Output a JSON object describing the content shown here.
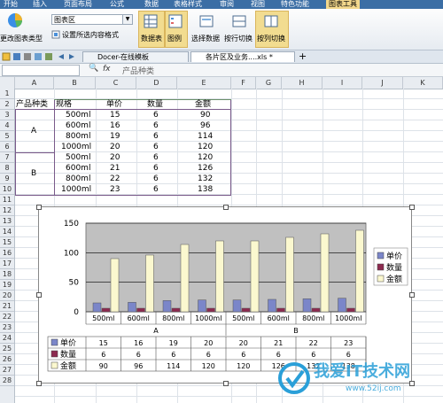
{
  "menubar": {
    "items": [
      "开始",
      "插入",
      "页面布局",
      "公式",
      "数据",
      "表格样式",
      "审阅",
      "视图",
      "特色功能",
      "图表工具"
    ],
    "active_index": 9
  },
  "ribbon": {
    "change_chart_type": "更改图表类型",
    "chart_area_select": "图表区",
    "format_selection": "设置所选内容格式",
    "data_table": "数据表",
    "legend": "图例",
    "select_data": "选择数据",
    "switch_by_row": "按行切换",
    "switch_by_col": "按列切换"
  },
  "tabs": [
    {
      "label": "Docer-在线模板"
    },
    {
      "label": "各片区及业务....xls *"
    }
  ],
  "formula_bar": {
    "fx": "fx",
    "content": "产品种类"
  },
  "columns": [
    "A",
    "B",
    "C",
    "D",
    "E",
    "F",
    "G",
    "H",
    "I",
    "J",
    "K"
  ],
  "rows": [
    "1",
    "2",
    "3",
    "4",
    "5",
    "6",
    "7",
    "8",
    "9",
    "10",
    "11",
    "12",
    "13",
    "14",
    "15",
    "16",
    "17",
    "18",
    "19",
    "20",
    "21",
    "22",
    "23",
    "24",
    "25",
    "26",
    "27",
    "28"
  ],
  "table": {
    "headers": [
      "产品种类",
      "规格",
      "单价",
      "数量",
      "金额"
    ],
    "groups": [
      "A",
      "B"
    ],
    "specs": [
      "500ml",
      "600ml",
      "800ml",
      "1000ml",
      "500ml",
      "600ml",
      "800ml",
      "1000ml"
    ],
    "price": [
      "15",
      "16",
      "19",
      "20",
      "20",
      "21",
      "22",
      "23"
    ],
    "qty": [
      "6",
      "6",
      "6",
      "6",
      "6",
      "6",
      "6",
      "6"
    ],
    "amount": [
      "90",
      "96",
      "114",
      "120",
      "120",
      "126",
      "132",
      "138"
    ]
  },
  "chart_data": {
    "type": "bar",
    "categories": [
      "500ml",
      "600ml",
      "800ml",
      "1000ml",
      "500ml",
      "600ml",
      "800ml",
      "1000ml"
    ],
    "groups": [
      "A",
      "B"
    ],
    "series": [
      {
        "name": "单价",
        "values": [
          15,
          16,
          19,
          20,
          20,
          21,
          22,
          23
        ],
        "color": "#7b86c9"
      },
      {
        "name": "数量",
        "values": [
          6,
          6,
          6,
          6,
          6,
          6,
          6,
          6
        ],
        "color": "#8c2a4f"
      },
      {
        "name": "金额",
        "values": [
          90,
          96,
          114,
          120,
          120,
          126,
          132,
          138
        ],
        "color": "#fbf8cf"
      }
    ],
    "yticks": [
      "0",
      "50",
      "100",
      "150"
    ],
    "ylim": [
      0,
      150
    ],
    "plot_bg": "#c0c0c0",
    "legend": "right",
    "data_table": true
  },
  "watermark": {
    "text": "我爱IT技术网",
    "url": "www.52ij.com"
  }
}
